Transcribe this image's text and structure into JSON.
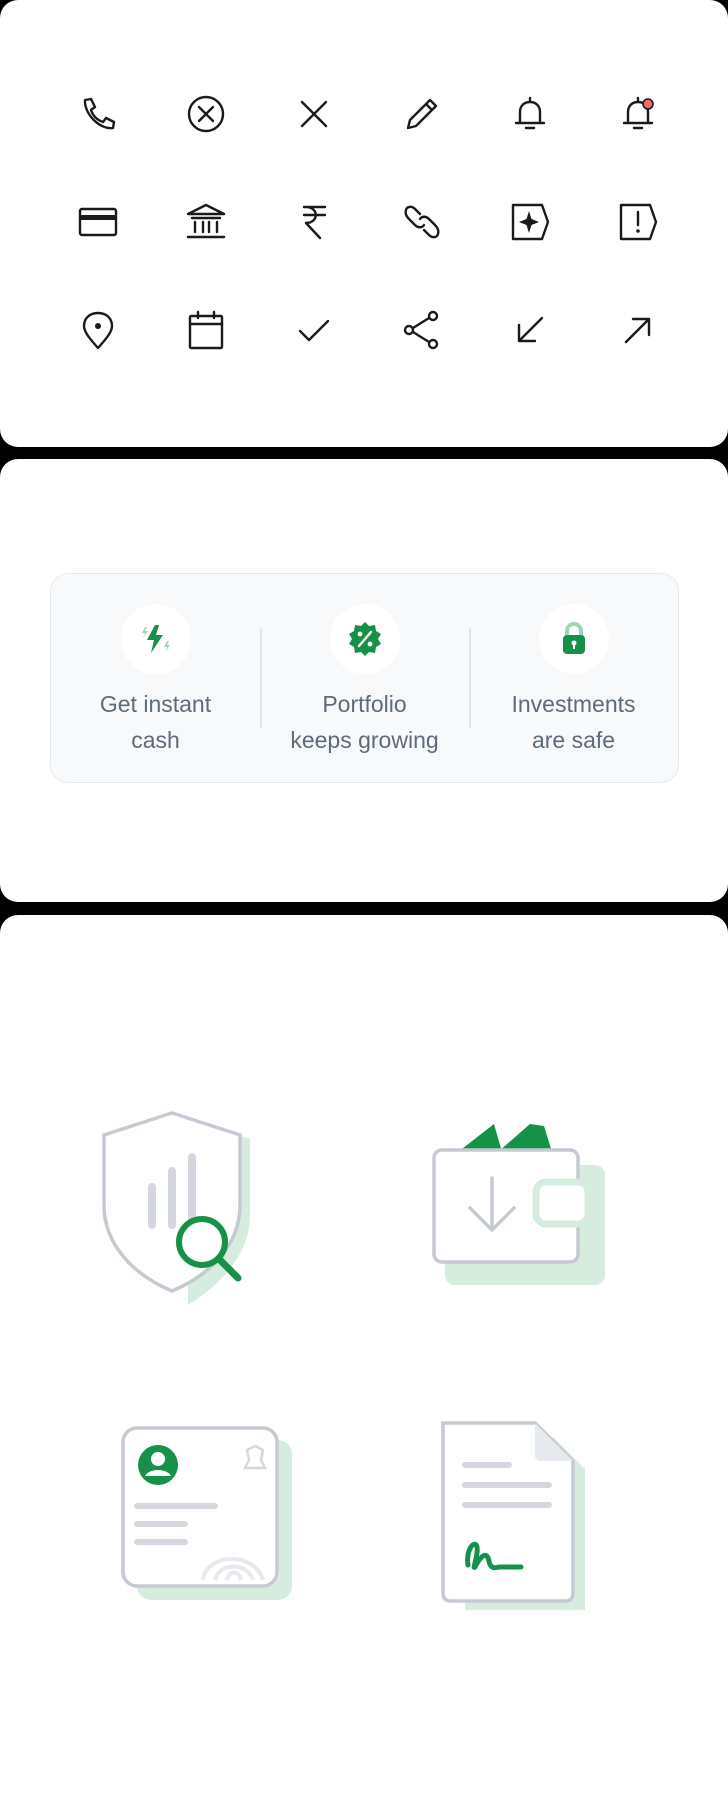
{
  "icons": [
    {
      "name": "phone-icon"
    },
    {
      "name": "close-circle-icon"
    },
    {
      "name": "close-icon"
    },
    {
      "name": "pencil-icon"
    },
    {
      "name": "bell-icon"
    },
    {
      "name": "bell-notification-icon"
    },
    {
      "name": "credit-card-icon"
    },
    {
      "name": "bank-icon"
    },
    {
      "name": "rupee-icon"
    },
    {
      "name": "link-icon"
    },
    {
      "name": "sparkle-badge-icon"
    },
    {
      "name": "alert-badge-icon"
    },
    {
      "name": "location-pin-icon"
    },
    {
      "name": "calendar-icon"
    },
    {
      "name": "check-icon"
    },
    {
      "name": "share-icon"
    },
    {
      "name": "arrow-down-left-icon"
    },
    {
      "name": "arrow-up-right-icon"
    }
  ],
  "benefits": [
    {
      "label": "Get instant\ncash",
      "icon": "lightning-icon"
    },
    {
      "label": "Portfolio\nkeeps growing",
      "icon": "percent-badge-icon"
    },
    {
      "label": "Investments\nare safe",
      "icon": "padlock-icon"
    }
  ],
  "illustrations": [
    {
      "icon": "shield-search-illustration"
    },
    {
      "icon": "wallet-download-illustration"
    },
    {
      "icon": "id-card-illustration"
    },
    {
      "icon": "signed-document-illustration"
    }
  ],
  "colors": {
    "accent": "#169147",
    "accent_light": "#d5ecde",
    "notification": "#f26b6b",
    "outline_gray": "#c5cad2",
    "text_muted": "#5f6b78"
  }
}
